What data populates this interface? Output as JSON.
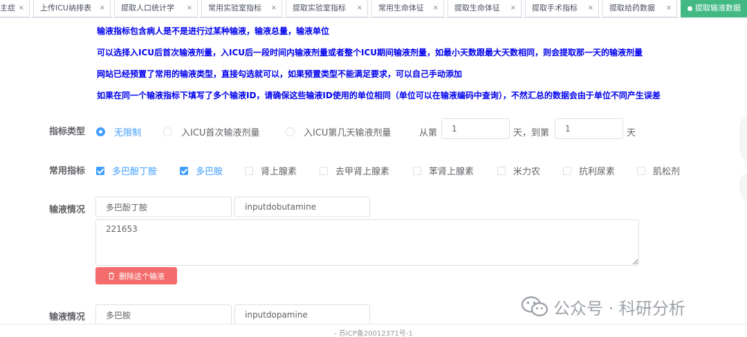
{
  "tabs": [
    {
      "label": "主症",
      "active": false
    },
    {
      "label": "上传ICU纳排表",
      "active": false
    },
    {
      "label": "提取人口统计学",
      "active": false
    },
    {
      "label": "常用实验室指标",
      "active": false
    },
    {
      "label": "提取实验室指标",
      "active": false
    },
    {
      "label": "常用生命体征",
      "active": false
    },
    {
      "label": "提取生命体征",
      "active": false
    },
    {
      "label": "提取手术指标",
      "active": false
    },
    {
      "label": "提取给药数据",
      "active": false
    },
    {
      "label": "提取输液数据",
      "active": true
    }
  ],
  "tab_close_glyph": "×",
  "notes": [
    "输液指标包含病人是不是进行过某种输液，输液总量，输液单位",
    "可以选择入ICU后首次输液剂量，入ICU后一段时间内输液剂量或者整个ICU期间输液剂量，如最小天数跟最大天数相同，则会提取那一天的输液剂量",
    "网站已经预置了常用的输液类型，直接勾选就可以，如果预置类型不能满足要求，可以自己手动添加",
    "如果在同一个输液指标下填写了多个输液ID，请确保这些输液ID使用的单位相同（单位可以在输液编码中查询），不然汇总的数据会由于单位不同产生误差"
  ],
  "indicator_type": {
    "label": "指标类型",
    "options": [
      {
        "label": "无限制",
        "checked": true
      },
      {
        "label": "入ICU首次输液剂量",
        "checked": false
      },
      {
        "label": "入ICU第几天输液剂量",
        "checked": false
      }
    ],
    "from_label": "从第",
    "from_value": "1",
    "to_label": "天，到第",
    "to_value": "1",
    "day_label": "天"
  },
  "common": {
    "label": "常用指标",
    "items": [
      {
        "label": "多巴酚丁胺",
        "checked": true
      },
      {
        "label": "多巴胺",
        "checked": true
      },
      {
        "label": "肾上腺素",
        "checked": false
      },
      {
        "label": "去甲肾上腺素",
        "checked": false
      },
      {
        "label": "苯肾上腺素",
        "checked": false
      },
      {
        "label": "米力农",
        "checked": false
      },
      {
        "label": "抗利尿素",
        "checked": false
      },
      {
        "label": "肌松剂",
        "checked": false
      }
    ]
  },
  "infusions": [
    {
      "label": "输液情况",
      "name": "多巴酚丁胺",
      "code": "inputdobutamine",
      "ids": "221653",
      "delete_label": "删除这个输液"
    },
    {
      "label": "输液情况",
      "name": "多巴胺",
      "code": "inputdopamine"
    }
  ],
  "watermark": "公众号 · 科研分析",
  "footer": "- 苏ICP备20012371号-1",
  "colors": {
    "primary": "#409eff",
    "active_tab": "#42b983",
    "note_text": "#0000ee",
    "danger": "#f56c6c"
  }
}
